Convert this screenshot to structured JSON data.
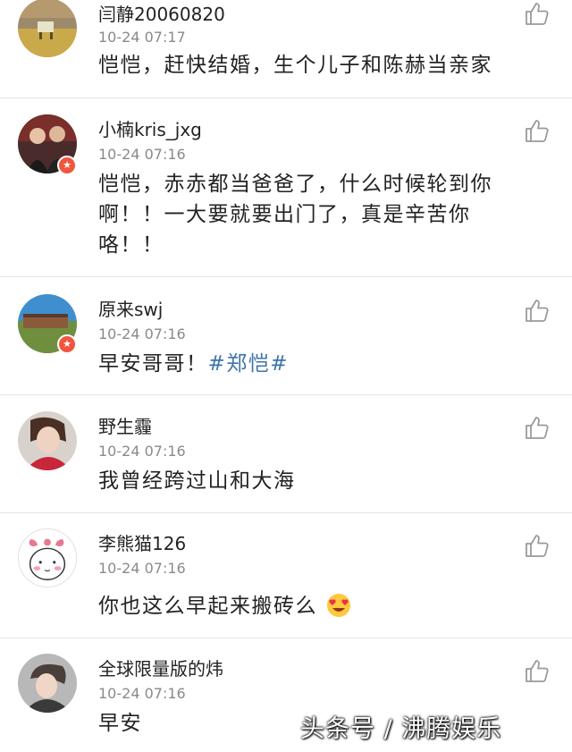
{
  "comments": [
    {
      "username": "闫静20060820",
      "time": "10-24 07:17",
      "text": "恺恺，赶快结婚，生个儿子和陈赫当亲家",
      "verified": false
    },
    {
      "username": "小楠kris_jxg",
      "time": "10-24 07:16",
      "text_lines": [
        "恺恺，赤赤都当爸爸了，什么时候轮到你",
        "啊！！一大要就要出门了，真是辛苦你",
        "咯！！"
      ],
      "verified": true,
      "badge": "★"
    },
    {
      "username": "原来swj",
      "time": "10-24 07:16",
      "text": "早安哥哥！",
      "hashtag": "#郑恺#",
      "verified": true,
      "badge": "★"
    },
    {
      "username": "野生霾",
      "time": "10-24 07:16",
      "text": "我曾经跨过山和大海",
      "verified": false
    },
    {
      "username": "李熊猫126",
      "time": "10-24 07:16",
      "text": "你也这么早起来搬砖么",
      "emoji": "heart-eyes-emoji",
      "verified": false
    },
    {
      "username": "全球限量版的炜",
      "time": "10-24 07:16",
      "text": "早安",
      "verified": false
    }
  ],
  "watermark": "头条号 / 沸腾娱乐",
  "icons": {
    "like": "thumbs-up-icon"
  },
  "colors": {
    "hashtag": "#3f74a8",
    "badge": "#f0563d",
    "time": "#8a8a8a"
  }
}
